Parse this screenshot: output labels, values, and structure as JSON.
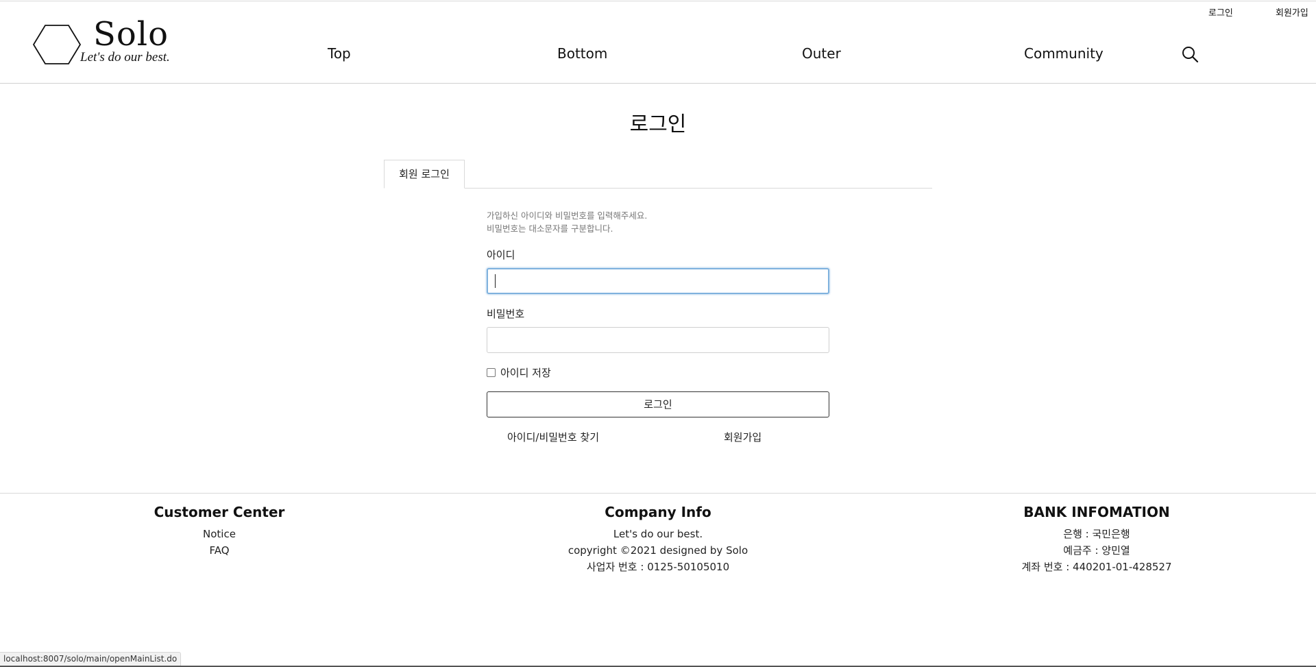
{
  "header": {
    "util_links": {
      "login": "로그인",
      "signup": "회원가입"
    },
    "logo": {
      "name": "Solo",
      "tagline": "Let's do our best."
    },
    "nav": [
      "Top",
      "Bottom",
      "Outer",
      "Community"
    ],
    "search_icon": "search-icon"
  },
  "main": {
    "title": "로그인",
    "tab": "회원 로그인",
    "guide_lines": [
      "가입하신 아이디와 비밀번호를 입력해주세요.",
      "비밀번호는 대소문자를 구분합니다."
    ],
    "id_label": "아이디",
    "id_value": "",
    "pw_label": "비밀번호",
    "pw_value": "",
    "save_id_label": "아이디 저장",
    "save_id_checked": false,
    "login_button": "로그인",
    "find_link": "아이디/비밀번호 찾기",
    "signup_link": "회원가입"
  },
  "footer": {
    "customer": {
      "title": "Customer Center",
      "links": [
        "Notice",
        "FAQ"
      ]
    },
    "company": {
      "title": "Company Info",
      "lines": [
        "Let's do our best.",
        "copyright ©2021 designed by Solo",
        "사업자 번호 : 0125-50105010"
      ]
    },
    "bank": {
      "title": "BANK INFOMATION",
      "lines": [
        "은행 : 국민은행",
        "예금주 : 양민열",
        "계좌 번호 : 440201-01-428527"
      ]
    }
  },
  "status_bar": {
    "url": "localhost:8007/solo/main/openMainList.do"
  },
  "colors": {
    "focus_border": "#7fb2de",
    "divider": "#d9d9d9",
    "text": "#111111"
  }
}
